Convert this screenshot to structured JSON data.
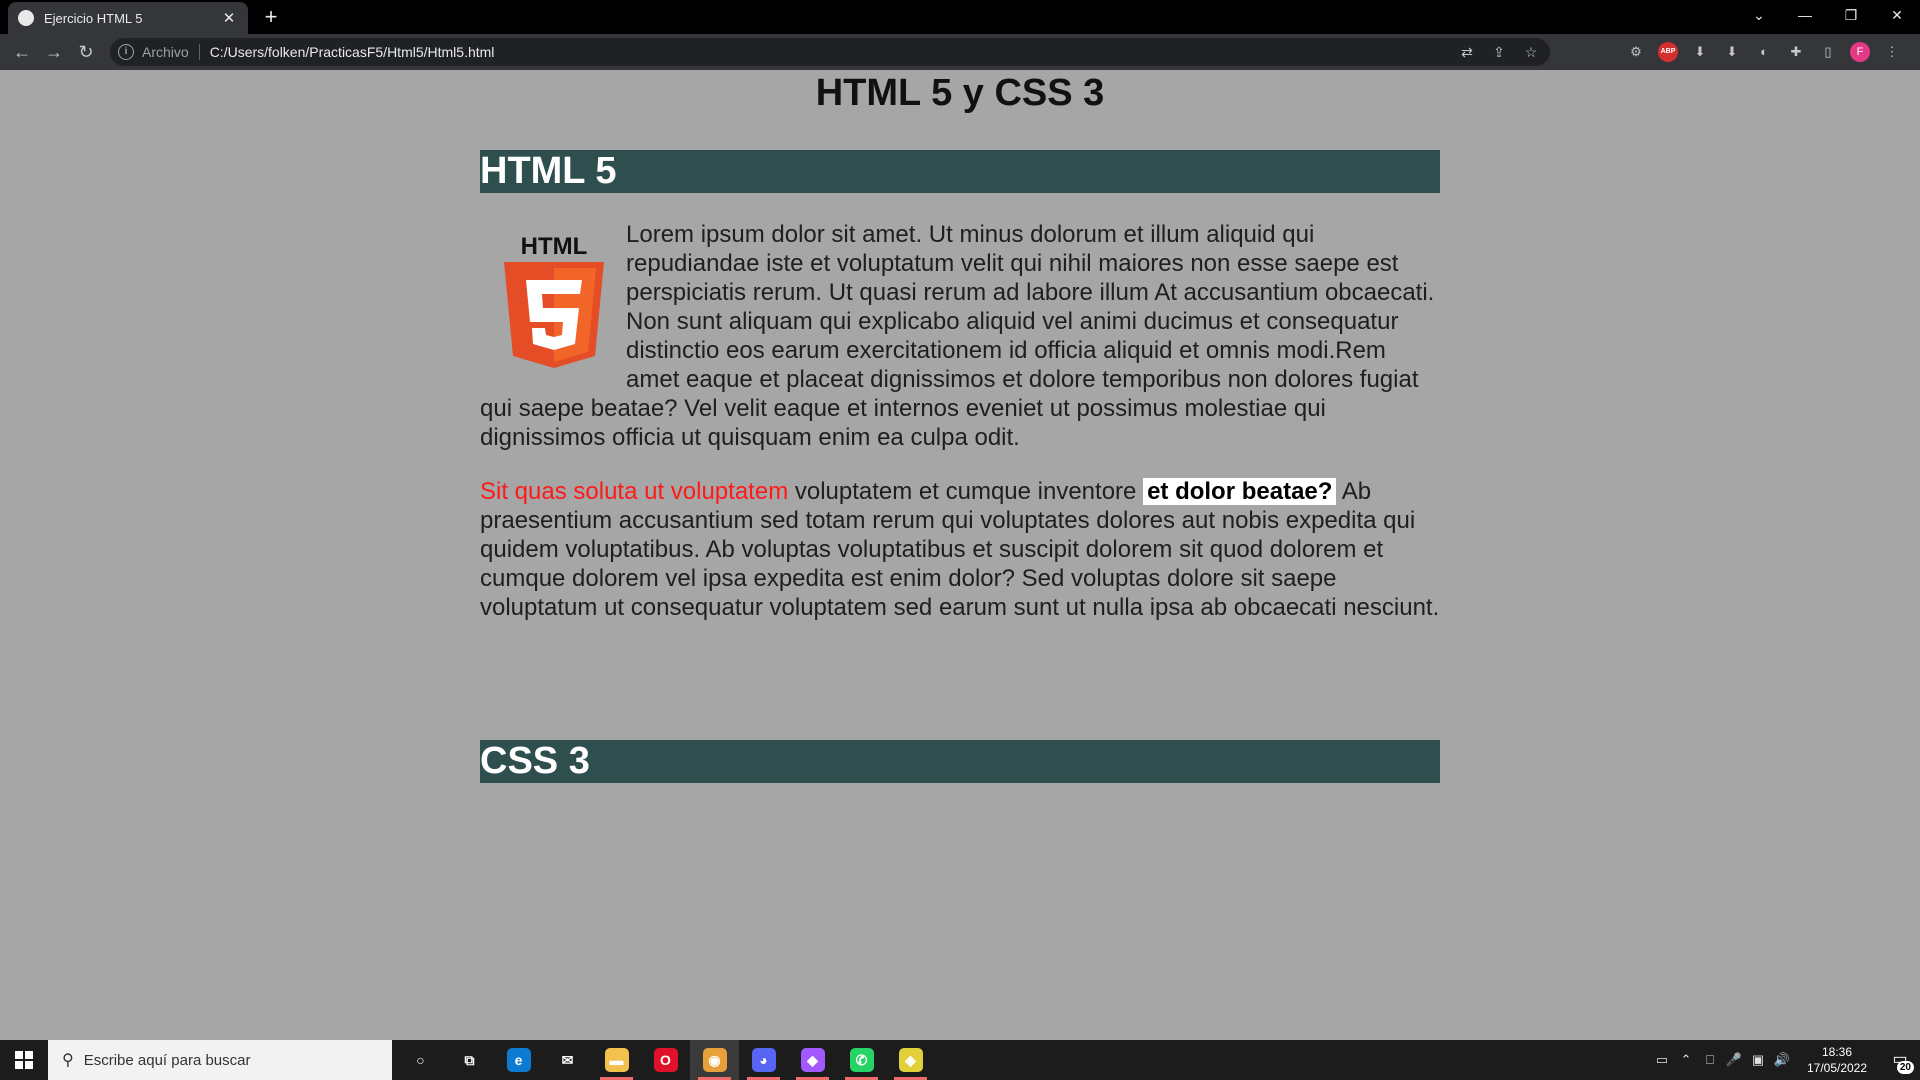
{
  "browser": {
    "tab_title": "Ejercicio HTML 5",
    "tab_close": "✕",
    "new_tab": "+",
    "scheme_label": "Archivo",
    "url": "C:/Users/folken/PracticasF5/Html5/Html5.html",
    "window_controls": {
      "tab_search": "⌄",
      "minimize": "—",
      "restore": "❐",
      "close": "✕"
    },
    "nav": {
      "back": "←",
      "forward": "→",
      "reload": "↻"
    },
    "omnibox_icons": [
      "translate-icon",
      "share-icon",
      "bookmark-star-icon"
    ],
    "extension_icons": [
      "extension-icon",
      "adblock-plus-icon",
      "download-arrow-icon",
      "download-arrow-icon",
      "color-wheel-icon",
      "puzzle-icon",
      "side-panel-icon"
    ],
    "abp_label": "ABP",
    "avatar_letter": "F"
  },
  "page": {
    "title": "HTML 5 y CSS 3",
    "sections": [
      {
        "heading": "HTML 5"
      },
      {
        "heading": "CSS 3"
      }
    ],
    "logo_text": "HTML",
    "logo_number": "5",
    "paragraph1": "Lorem ipsum dolor sit amet. Ut minus dolorum et illum aliquid qui repudiandae iste et voluptatum velit qui nihil maiores non esse saepe est perspiciatis rerum. Ut quasi rerum ad labore illum At accusantium obcaecati. Non sunt aliquam qui explicabo aliquid vel animi ducimus et consequatur distinctio eos earum exercitationem id officia aliquid et omnis modi.Rem amet eaque et placeat dignissimos et dolore temporibus non dolores fugiat qui saepe beatae? Vel velit eaque et internos eveniet ut possimus molestiae qui dignissimos officia ut quisquam enim ea culpa odit.",
    "paragraph2": {
      "red": "Sit quas soluta ut voluptatem",
      "plain1": " voluptatem et cumque inventore ",
      "highlight": "et dolor beatae?",
      "plain2": " Ab praesentium accusantium sed totam rerum qui voluptates dolores aut nobis expedita qui quidem voluptatibus. Ab voluptas voluptatibus et suscipit dolorem sit quod dolorem et cumque dolorem vel ipsa expedita est enim dolor? Sed voluptas dolore sit saepe voluptatum ut consequatur voluptatem sed earum sunt ut nulla ipsa ab obcaecati nesciunt."
    },
    "colors": {
      "background": "#a6a6a6",
      "section_bar": "#2f4f4f",
      "red_text": "#ff1a1a",
      "logo_orange": "#e44d26"
    }
  },
  "taskbar": {
    "search_placeholder": "Escribe aquí para buscar",
    "apps": [
      {
        "name": "cortana-icon",
        "glyph": "○",
        "running": false,
        "active": false,
        "color": "transparent"
      },
      {
        "name": "task-view-icon",
        "glyph": "⧉",
        "running": false,
        "active": false,
        "color": "transparent"
      },
      {
        "name": "edge-icon",
        "glyph": "e",
        "running": false,
        "active": false,
        "color": "#0c7bd1"
      },
      {
        "name": "mail-icon",
        "glyph": "✉",
        "running": false,
        "active": false,
        "color": "transparent"
      },
      {
        "name": "file-explorer-icon",
        "glyph": "▬",
        "running": true,
        "active": false,
        "color": "#f2c14e"
      },
      {
        "name": "opera-icon",
        "glyph": "O",
        "running": false,
        "active": false,
        "color": "#e0112b"
      },
      {
        "name": "chrome-icon",
        "glyph": "◉",
        "running": true,
        "active": true,
        "color": "#e8a13a"
      },
      {
        "name": "discord-icon",
        "glyph": "◕",
        "running": true,
        "active": false,
        "color": "#5865f2"
      },
      {
        "name": "figma-icon",
        "glyph": "◆",
        "running": true,
        "active": false,
        "color": "#a259ff"
      },
      {
        "name": "whatsapp-icon",
        "glyph": "✆",
        "running": true,
        "active": false,
        "color": "#25d366"
      },
      {
        "name": "git-icon",
        "glyph": "◈",
        "running": true,
        "active": false,
        "color": "#e2d03b"
      }
    ],
    "tray_icons": [
      "keyboard-layout-icon",
      "chevron-up-icon",
      "device-icon",
      "microphone-icon",
      "network-icon",
      "volume-icon"
    ],
    "tray_glyphs": [
      "▭",
      "⌃",
      "⎕",
      "🎤",
      "▣",
      "🔊"
    ],
    "time": "18:36",
    "date": "17/05/2022",
    "notification_count": "20"
  }
}
